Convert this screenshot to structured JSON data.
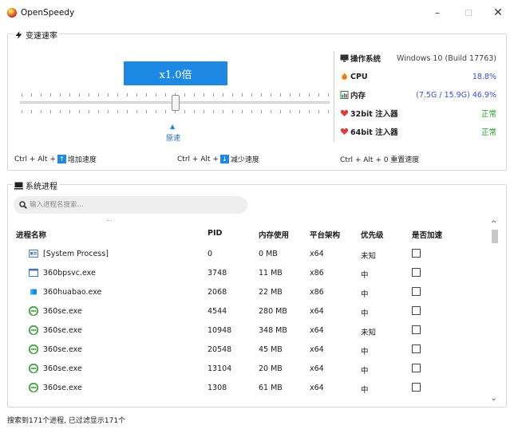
{
  "window": {
    "title": "OpenSpeedy",
    "min": "–",
    "max": "☐",
    "close": "✕"
  },
  "speed": {
    "group_title": "变速速率",
    "display": "x1.0倍",
    "origin_label": "原速",
    "hotkey_increase": {
      "prefix": "Ctrl + Alt +",
      "key": "↑",
      "label": "增加速度"
    },
    "hotkey_decrease": {
      "prefix": "Ctrl + Alt +",
      "key": "↓",
      "label": "减少速度"
    },
    "hotkey_reset": "Ctrl + Alt + 0 重置速度"
  },
  "info": {
    "os": {
      "label": "操作系统",
      "value": "Windows 10 (Build 17763)",
      "icon": "monitor-icon"
    },
    "cpu": {
      "label": "CPU",
      "value": "18.8%",
      "icon": "cpu-icon",
      "color": "#3a50d9"
    },
    "mem": {
      "label": "内存",
      "value": "(7.5G / 15.9G) 46.9%",
      "icon": "chart-icon",
      "color": "#3a50d9"
    },
    "inj32": {
      "label": "32bit 注入器",
      "value": "正常",
      "icon": "heart-icon",
      "color": "#1e9e1e"
    },
    "inj64": {
      "label": "64bit 注入器",
      "value": "正常",
      "icon": "heart-icon",
      "color": "#1e9e1e"
    }
  },
  "process": {
    "group_title": "系统进程",
    "search_placeholder": "输入进程名搜索...",
    "columns": [
      "进程名称",
      "PID",
      "内存使用",
      "平台架构",
      "优先级",
      "是否加速"
    ],
    "rows": [
      {
        "icon": "system-icon",
        "name": "[System Process]",
        "pid": "0",
        "mem": "0 MB",
        "arch": "x64",
        "priority": "未知"
      },
      {
        "icon": "window-icon",
        "name": "360bpsvc.exe",
        "pid": "3748",
        "mem": "11 MB",
        "arch": "x86",
        "priority": "中"
      },
      {
        "icon": "app-icon",
        "name": "360huabao.exe",
        "pid": "2068",
        "mem": "22 MB",
        "arch": "x86",
        "priority": "中"
      },
      {
        "icon": "browser-icon",
        "name": "360se.exe",
        "pid": "4544",
        "mem": "280 MB",
        "arch": "x64",
        "priority": "中"
      },
      {
        "icon": "browser-icon",
        "name": "360se.exe",
        "pid": "10948",
        "mem": "348 MB",
        "arch": "x64",
        "priority": "未知"
      },
      {
        "icon": "browser-icon",
        "name": "360se.exe",
        "pid": "20548",
        "mem": "45 MB",
        "arch": "x64",
        "priority": "中"
      },
      {
        "icon": "browser-icon",
        "name": "360se.exe",
        "pid": "13104",
        "mem": "20 MB",
        "arch": "x64",
        "priority": "中"
      },
      {
        "icon": "browser-icon",
        "name": "360se.exe",
        "pid": "1308",
        "mem": "61 MB",
        "arch": "x64",
        "priority": "中"
      }
    ]
  },
  "status": "搜索到171个进程, 已过滤显示171个"
}
